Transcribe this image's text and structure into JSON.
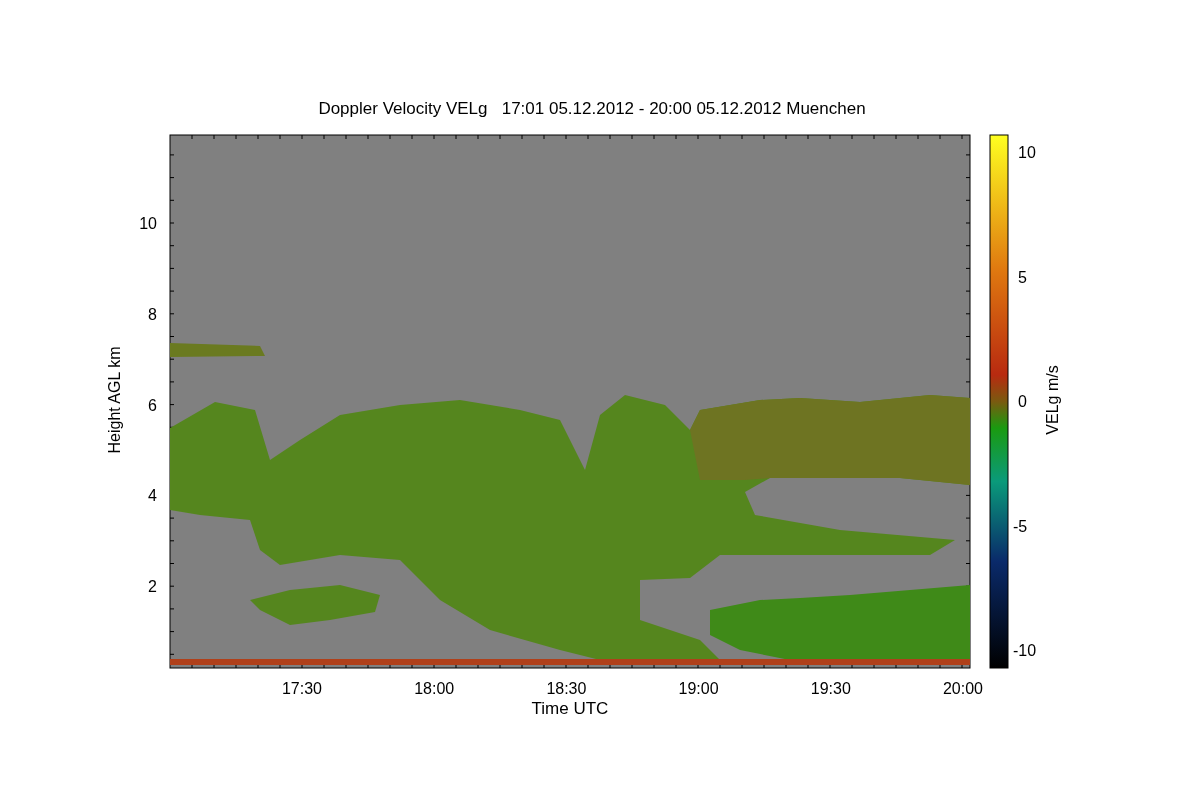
{
  "title": "Doppler Velocity VELg   17:01 05.12.2012 - 20:00 05.12.2012 Muenchen",
  "y_axis": {
    "label": "Height AGL km",
    "ticks": [
      "10",
      "8",
      "6",
      "4",
      "2"
    ]
  },
  "x_axis": {
    "label": "Time UTC",
    "ticks": [
      "17:30",
      "18:00",
      "18:30",
      "19:00",
      "19:30",
      "20:00"
    ]
  },
  "colorbar": {
    "label": "VELg m/s",
    "ticks": [
      "10",
      "5",
      "0",
      "-5",
      "-10"
    ]
  }
}
